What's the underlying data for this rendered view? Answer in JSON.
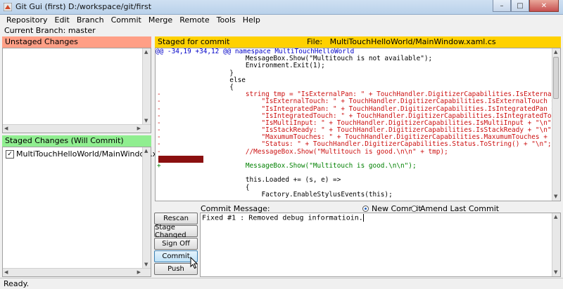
{
  "window": {
    "title": "Git Gui (first) D:/workspace/git/first",
    "minimize": "–",
    "maximize": "□",
    "close": "✕"
  },
  "menu": [
    "Repository",
    "Edit",
    "Branch",
    "Commit",
    "Merge",
    "Remote",
    "Tools",
    "Help"
  ],
  "branch": "Current Branch: master",
  "unstaged": {
    "header": "Unstaged Changes"
  },
  "staged": {
    "header": "Staged Changes (Will Commit)",
    "files": [
      "MultiTouchHelloWorld/MainWindow.xaml.cs"
    ]
  },
  "diff": {
    "header": "Staged for commit",
    "file_label": "File:",
    "file_name": "MultiTouchHelloWorld/MainWindow.xaml.cs",
    "hunk": "@@ -34,19 +34,12 @@ namespace MultiTouchHelloWorld",
    "lines": [
      {
        "type": "ctx",
        "mark": "",
        "text": "                    MessageBox.Show(\"Multitouch is not available\");"
      },
      {
        "type": "ctx",
        "mark": "",
        "text": "                    Environment.Exit(1);"
      },
      {
        "type": "ctx",
        "mark": "",
        "text": "                }"
      },
      {
        "type": "ctx",
        "mark": "",
        "text": "                else"
      },
      {
        "type": "ctx",
        "mark": "",
        "text": "                {"
      },
      {
        "type": "del",
        "mark": "-",
        "text": "                    string tmp = \"IsExternalPan: \" + TouchHandler.DigitizerCapabilities.IsExternalPan + \"\\n\" +"
      },
      {
        "type": "del",
        "mark": "-",
        "text": "                        \"IsExternalTouch: \" + TouchHandler.DigitizerCapabilities.IsExternalTouch + \"\\n\" +"
      },
      {
        "type": "del",
        "mark": "-",
        "text": "                        \"IsIntegratedPan: \" + TouchHandler.DigitizerCapabilities.IsIntegratedPan + \"\\n\" +"
      },
      {
        "type": "del",
        "mark": "-",
        "text": "                        \"IsIntegratedTouch: \" + TouchHandler.DigitizerCapabilities.IsIntegratedTouch + \"\\n\" +"
      },
      {
        "type": "del",
        "mark": "-",
        "text": "                        \"IsMultiInput: \" + TouchHandler.DigitizerCapabilities.IsMultiInput + \"\\n\" +"
      },
      {
        "type": "del",
        "mark": "-",
        "text": "                        \"IsStackReady: \" + TouchHandler.DigitizerCapabilities.IsStackReady + \"\\n\" +"
      },
      {
        "type": "del",
        "mark": "-",
        "text": "                        \"MaxumumTouches: \" + TouchHandler.DigitizerCapabilities.MaxumumTouches + \"\\n\" +"
      },
      {
        "type": "del",
        "mark": "-",
        "text": "                        \"Status: \" + TouchHandler.DigitizerCapabilities.Status.ToString() + \"\\n\";"
      },
      {
        "type": "del",
        "mark": "-",
        "text": "                    //MessageBox.Show(\"Multitouch is good.\\n\\n\" + tmp);"
      },
      {
        "type": "redbar",
        "mark": "-",
        "text": ""
      },
      {
        "type": "add",
        "mark": "+",
        "text": "                    MessageBox.Show(\"Multitouch is good.\\n\\n\");"
      },
      {
        "type": "ctx",
        "mark": "",
        "text": ""
      },
      {
        "type": "ctx",
        "mark": "",
        "text": "                    this.Loaded += (s, e) =>"
      },
      {
        "type": "ctx",
        "mark": "",
        "text": "                    {"
      },
      {
        "type": "ctx",
        "mark": "",
        "text": "                        Factory.EnableStylusEvents(this);"
      }
    ]
  },
  "buttons": {
    "rescan": "Rescan",
    "stage_changed": "Stage Changed",
    "sign_off": "Sign Off",
    "commit": "Commit",
    "push": "Push"
  },
  "commit_message": {
    "label": "Commit Message:",
    "new_commit": "New Commit",
    "amend": "Amend Last Commit",
    "selected": "New Commit",
    "text": "Fixed #1 : Removed debug informatioin."
  },
  "status": "Ready."
}
